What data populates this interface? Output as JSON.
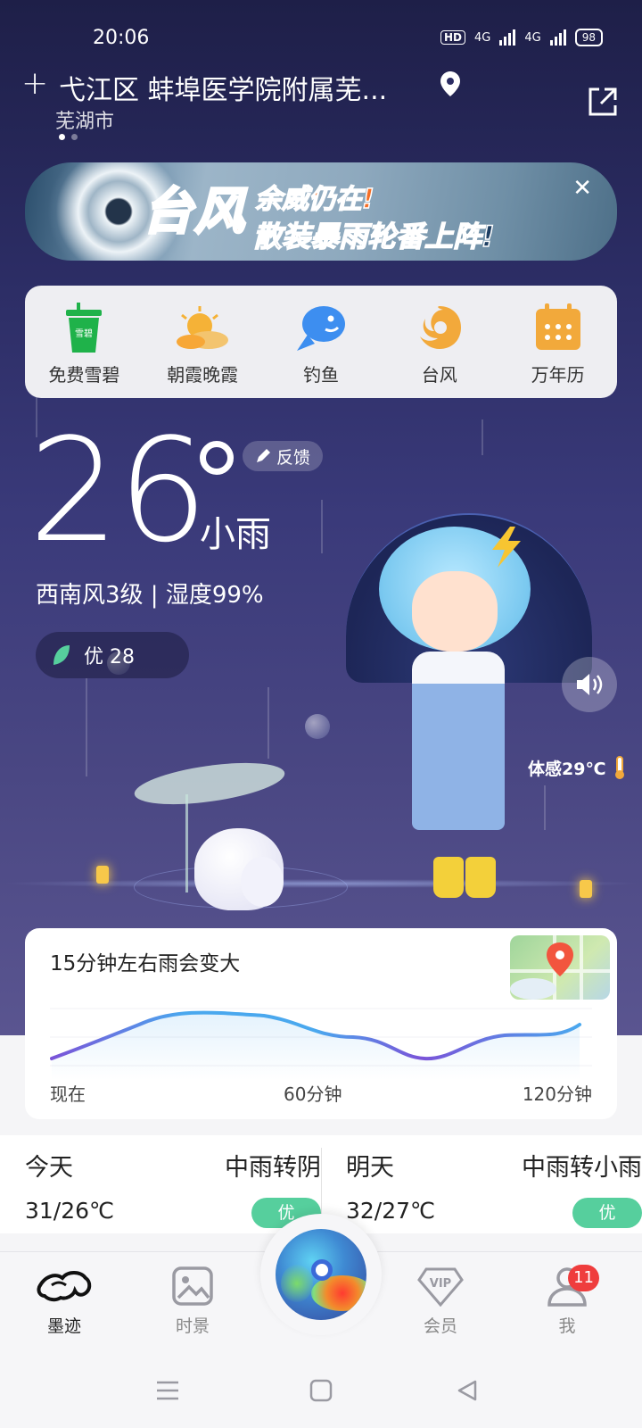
{
  "status_bar": {
    "time": "20:06",
    "hd_badge": "HD",
    "net1": "4G",
    "net2": "4G",
    "battery": "98"
  },
  "header": {
    "add_label": "+",
    "location": "弋江区 蚌埠医学院附属芜...",
    "city": "芜湖市"
  },
  "banner": {
    "big_text": "台风",
    "top_text": "余威仍在!",
    "bottom_text": "散装暴雨轮番上阵!",
    "close_label": "✕"
  },
  "quick_menu": [
    {
      "label": "免费雪碧",
      "icon": "drink-cup-icon",
      "color": "#1fb24a"
    },
    {
      "label": "朝霞晚霞",
      "icon": "sun-cloud-icon",
      "color": "#f5a623"
    },
    {
      "label": "钓鱼",
      "icon": "fish-icon",
      "color": "#3d8ef0"
    },
    {
      "label": "台风",
      "icon": "typhoon-icon",
      "color": "#f2a93b"
    },
    {
      "label": "万年历",
      "icon": "calendar-icon",
      "color": "#f2a93b"
    }
  ],
  "weather": {
    "temperature": "26",
    "condition": "小雨",
    "feedback_label": "反馈",
    "wind_humidity": "西南风3级 | 湿度99%",
    "aqi_text": "优 28",
    "feels_like": "体感29℃"
  },
  "precip": {
    "title": "15分钟左右雨会变大",
    "time_labels": [
      "现在",
      "60分钟",
      "120分钟"
    ]
  },
  "daily": [
    {
      "name": "今天",
      "condition": "中雨转阴",
      "temp": "31/26℃",
      "aqi": "优"
    },
    {
      "name": "明天",
      "condition": "中雨转小雨",
      "temp": "32/27℃",
      "aqi": "优"
    }
  ],
  "tabs": [
    {
      "label": "墨迹",
      "icon": "moji-logo-icon"
    },
    {
      "label": "时景",
      "icon": "photo-icon"
    },
    {
      "label": "会员",
      "icon": "vip-icon"
    },
    {
      "label": "我",
      "icon": "user-icon",
      "badge": "11"
    }
  ],
  "colors": {
    "sky_top": "#1e1f48",
    "sky_bottom": "#5a5590",
    "aqi_good": "#56cf9d",
    "badge_red": "#ef3d3d",
    "precip_line": "#6a5ee0"
  }
}
